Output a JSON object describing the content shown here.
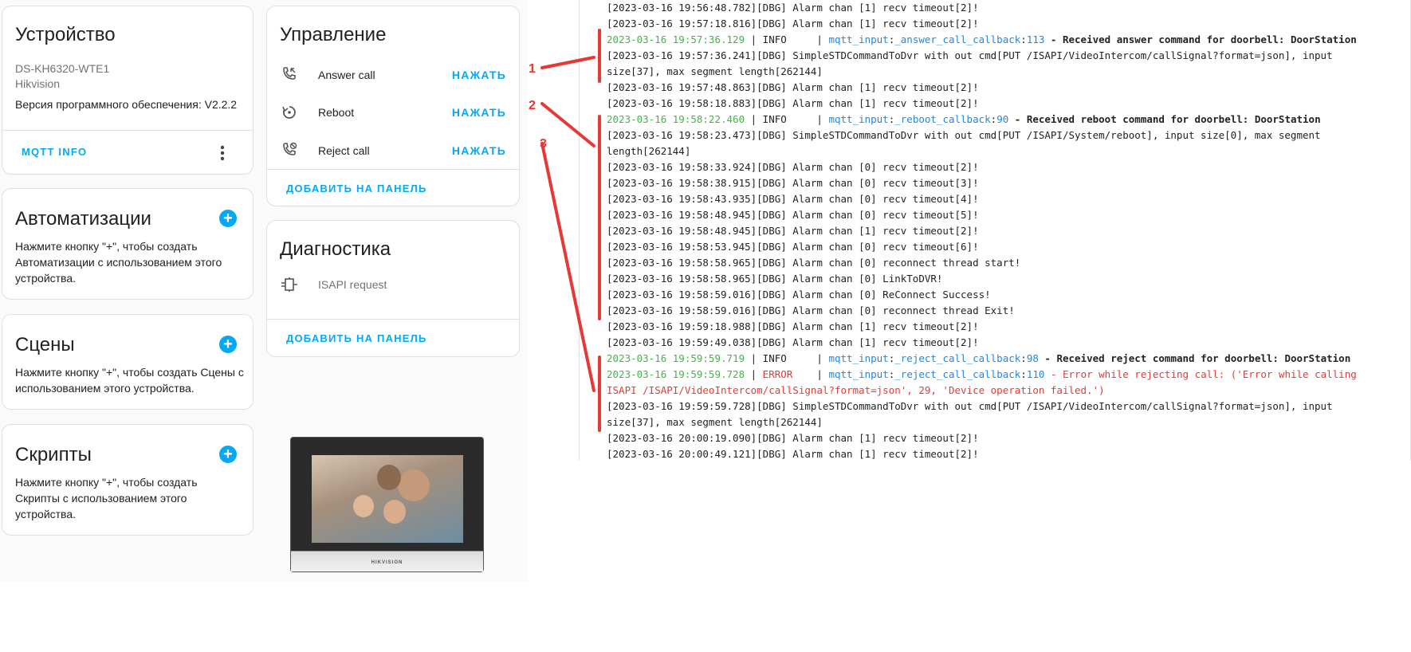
{
  "device_card": {
    "title": "Устройство",
    "model": "DS-KH6320-WTE1",
    "manufacturer": "Hikvision",
    "firmware": "Версия программного обеспечения: V2.2.2",
    "mqtt_button": "MQTT INFO"
  },
  "controls_card": {
    "title": "Управление",
    "items": [
      {
        "label": "Answer call",
        "action": "НАЖАТЬ",
        "icon": "phone-answer-icon"
      },
      {
        "label": "Reboot",
        "action": "НАЖАТЬ",
        "icon": "restart-icon"
      },
      {
        "label": "Reject call",
        "action": "НАЖАТЬ",
        "icon": "phone-reject-icon"
      }
    ],
    "add_to_panel": "ДОБАВИТЬ НА ПАНЕЛЬ"
  },
  "automations_card": {
    "title": "Автоматизации",
    "text": "Нажмите кнопку \"+\", чтобы создать Автоматизации с использованием этого устройства."
  },
  "diagnostics_card": {
    "title": "Диагностика",
    "items": [
      {
        "label": "ISAPI request",
        "icon": "connection-icon"
      }
    ],
    "add_to_panel": "ДОБАВИТЬ НА ПАНЕЛЬ"
  },
  "scenes_card": {
    "title": "Сцены",
    "text": "Нажмите кнопку \"+\", чтобы создать Сцены с использованием этого устройства."
  },
  "scripts_card": {
    "title": "Скрипты",
    "text": "Нажмите кнопку \"+\", чтобы создать Скрипты с использованием этого устройства."
  },
  "device_image": {
    "brand": "HIKVISION"
  },
  "annotations": [
    "1",
    "2",
    "3"
  ],
  "colors": {
    "accent": "#03a9f4",
    "log_green": "#4caf50",
    "log_blue": "#1e88e5",
    "log_red": "#e53935",
    "annotation_red": "#e53935"
  },
  "log": [
    [
      {
        "t": "[2023-03-16 19:56:48.782][DBG] Alarm chan [1] recv timeout[2]!"
      }
    ],
    [
      {
        "t": "[2023-03-16 19:57:18.816][DBG] Alarm chan [1] recv timeout[2]!"
      }
    ],
    [
      {
        "t": "2023-03-16 19:57:36.129",
        "c": "green"
      },
      {
        "t": " | INFO     | "
      },
      {
        "t": "mqtt_input",
        "c": "blue"
      },
      {
        "t": ":"
      },
      {
        "t": "_answer_call_callback",
        "c": "blue"
      },
      {
        "t": ":"
      },
      {
        "t": "113",
        "c": "blue"
      },
      {
        "t": " - Received answer command for doorbell: DoorStation",
        "c": "bold"
      }
    ],
    [
      {
        "t": "[2023-03-16 19:57:36.241][DBG] SimpleSTDCommandToDvr with out cmd[PUT /ISAPI/VideoIntercom/callSignal?format=json], input"
      }
    ],
    [
      {
        "t": "size[37], max segment length[262144]"
      }
    ],
    [
      {
        "t": "[2023-03-16 19:57:48.863][DBG] Alarm chan [1] recv timeout[2]!"
      }
    ],
    [
      {
        "t": "[2023-03-16 19:58:18.883][DBG] Alarm chan [1] recv timeout[2]!"
      }
    ],
    [
      {
        "t": "2023-03-16 19:58:22.460",
        "c": "green"
      },
      {
        "t": " | INFO     | "
      },
      {
        "t": "mqtt_input",
        "c": "blue"
      },
      {
        "t": ":"
      },
      {
        "t": "_reboot_callback",
        "c": "blue"
      },
      {
        "t": ":"
      },
      {
        "t": "90",
        "c": "blue"
      },
      {
        "t": " - Received reboot command for doorbell: DoorStation",
        "c": "bold"
      }
    ],
    [
      {
        "t": "[2023-03-16 19:58:23.473][DBG] SimpleSTDCommandToDvr with out cmd[PUT /ISAPI/System/reboot], input size[0], max segment"
      }
    ],
    [
      {
        "t": "length[262144]"
      }
    ],
    [
      {
        "t": "[2023-03-16 19:58:33.924][DBG] Alarm chan [0] recv timeout[2]!"
      }
    ],
    [
      {
        "t": "[2023-03-16 19:58:38.915][DBG] Alarm chan [0] recv timeout[3]!"
      }
    ],
    [
      {
        "t": "[2023-03-16 19:58:43.935][DBG] Alarm chan [0] recv timeout[4]!"
      }
    ],
    [
      {
        "t": "[2023-03-16 19:58:48.945][DBG] Alarm chan [0] recv timeout[5]!"
      }
    ],
    [
      {
        "t": "[2023-03-16 19:58:48.945][DBG] Alarm chan [1] recv timeout[2]!"
      }
    ],
    [
      {
        "t": "[2023-03-16 19:58:53.945][DBG] Alarm chan [0] recv timeout[6]!"
      }
    ],
    [
      {
        "t": "[2023-03-16 19:58:58.965][DBG] Alarm chan [0] reconnect thread start!"
      }
    ],
    [
      {
        "t": "[2023-03-16 19:58:58.965][DBG] Alarm chan [0] LinkToDVR!"
      }
    ],
    [
      {
        "t": "[2023-03-16 19:58:59.016][DBG] Alarm chan [0] ReConnect Success!"
      }
    ],
    [
      {
        "t": "[2023-03-16 19:58:59.016][DBG] Alarm chan [0] reconnect thread Exit!"
      }
    ],
    [
      {
        "t": "[2023-03-16 19:59:18.988][DBG] Alarm chan [1] recv timeout[2]!"
      }
    ],
    [
      {
        "t": "[2023-03-16 19:59:49.038][DBG] Alarm chan [1] recv timeout[2]!"
      }
    ],
    [
      {
        "t": "2023-03-16 19:59:59.719",
        "c": "green"
      },
      {
        "t": " | INFO     | "
      },
      {
        "t": "mqtt_input",
        "c": "blue"
      },
      {
        "t": ":"
      },
      {
        "t": "_reject_call_callback",
        "c": "blue"
      },
      {
        "t": ":"
      },
      {
        "t": "98",
        "c": "blue"
      },
      {
        "t": " - Received reject command for doorbell: DoorStation",
        "c": "bold"
      }
    ],
    [
      {
        "t": "2023-03-16 19:59:59.728",
        "c": "green"
      },
      {
        "t": " | "
      },
      {
        "t": "ERROR",
        "c": "red"
      },
      {
        "t": "    | "
      },
      {
        "t": "mqtt_input",
        "c": "blue"
      },
      {
        "t": ":"
      },
      {
        "t": "_reject_call_callback",
        "c": "blue"
      },
      {
        "t": ":"
      },
      {
        "t": "110",
        "c": "blue"
      },
      {
        "t": " - Error while rejecting call: ('Error while calling",
        "c": "red"
      }
    ],
    [
      {
        "t": "ISAPI /ISAPI/VideoIntercom/callSignal?format=json', 29, 'Device operation failed.')",
        "c": "red"
      }
    ],
    [
      {
        "t": "[2023-03-16 19:59:59.728][DBG] SimpleSTDCommandToDvr with out cmd[PUT /ISAPI/VideoIntercom/callSignal?format=json], input"
      }
    ],
    [
      {
        "t": "size[37], max segment length[262144]"
      }
    ],
    [
      {
        "t": "[2023-03-16 20:00:19.090][DBG] Alarm chan [1] recv timeout[2]!"
      }
    ],
    [
      {
        "t": "[2023-03-16 20:00:49.121][DBG] Alarm chan [1] recv timeout[2]!"
      }
    ]
  ]
}
